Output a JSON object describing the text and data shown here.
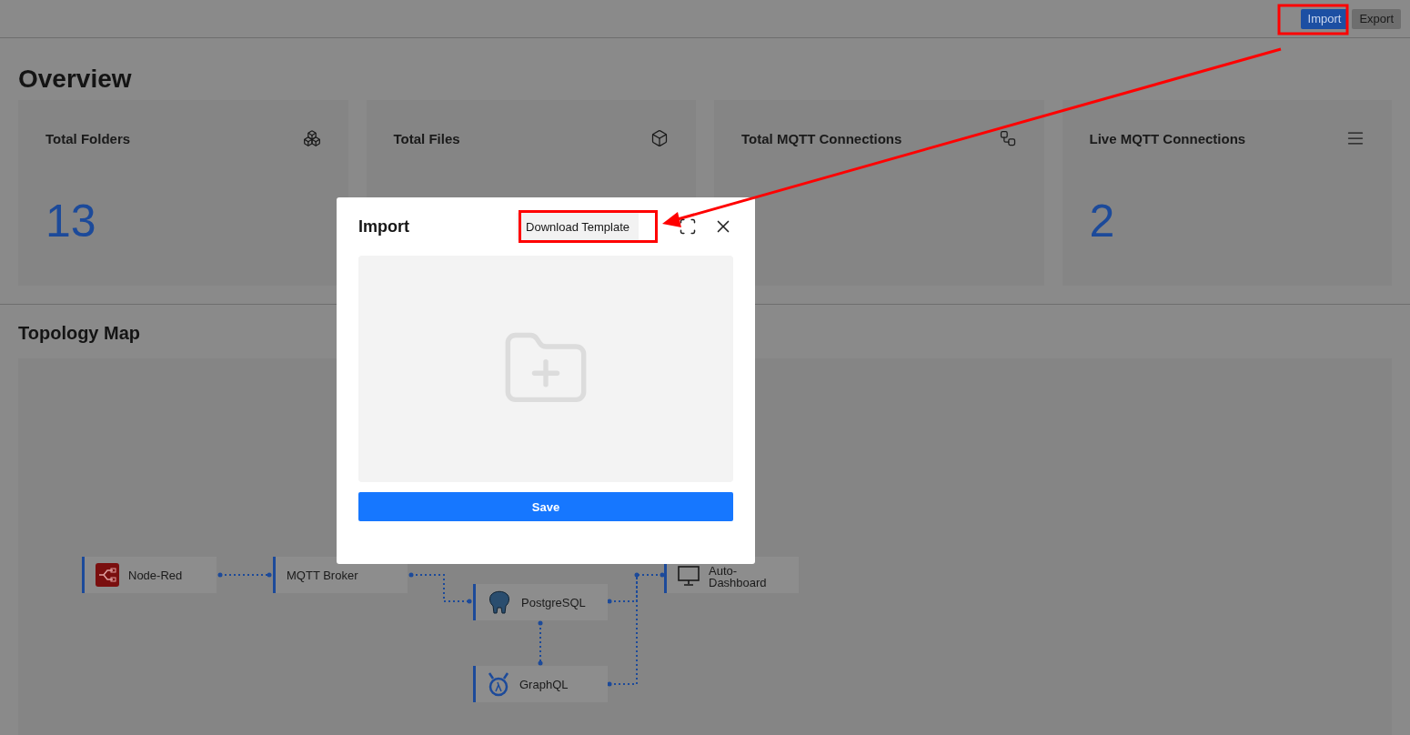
{
  "header": {
    "buttons": [
      {
        "label": "Import",
        "selected": true
      },
      {
        "label": "Export",
        "selected": false
      }
    ]
  },
  "overview": {
    "title": "Overview",
    "cards": [
      {
        "label": "Total Folders",
        "value": "13",
        "kind": "folders"
      },
      {
        "label": "Total Files",
        "kind": "files"
      },
      {
        "label": "Total MQTT Connections",
        "kind": "connections"
      },
      {
        "label": "Live MQTT Connections",
        "value": "2",
        "kind": "live"
      }
    ]
  },
  "topology": {
    "title": "Topology Map",
    "nodes": [
      {
        "label": "Node-Red",
        "kind": "nodered"
      },
      {
        "label": "MQTT Broker",
        "kind": "broker"
      },
      {
        "label": "PostgreSQL",
        "kind": "postgres"
      },
      {
        "label": "GraphQL",
        "kind": "graphql"
      },
      {
        "label": "Auto-\nDashboard",
        "kind": "dashboard"
      }
    ]
  },
  "dialog": {
    "title": "Import",
    "download_button": "Download Template",
    "save_button": "Save"
  }
}
